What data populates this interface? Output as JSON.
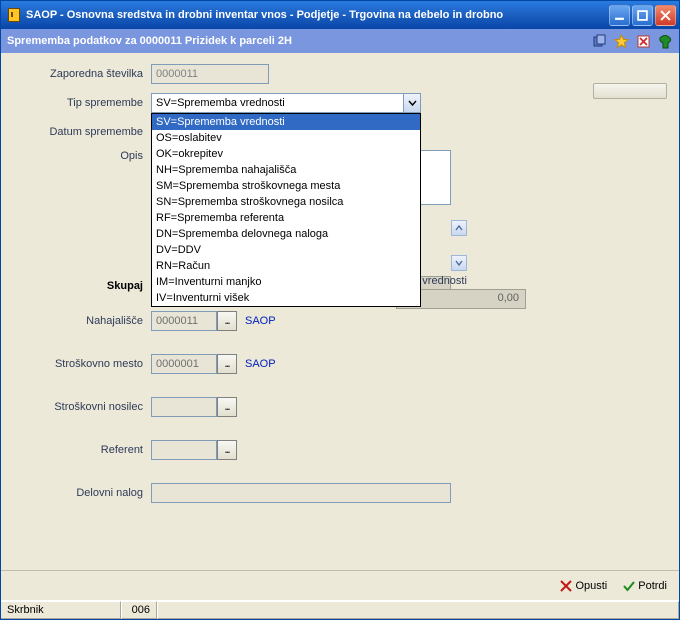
{
  "window": {
    "title": "SAOP  -  Osnovna sredstva in drobni inventar vnos - Podjetje - Trgovina na debelo in drobno"
  },
  "toolbar": {
    "title": "Sprememba podatkov za 0000011 Prizidek k parceli 2H"
  },
  "labels": {
    "seq": "Zaporedna številka",
    "type": "Tip spremembe",
    "date": "Datum spremembe",
    "desc": "Opis",
    "total": "Skupaj",
    "location": "Nahajališče",
    "cost_center": "Stroškovno mesto",
    "cost_carrier": "Stroškovni nosilec",
    "referent": "Referent",
    "work_order": "Delovni nalog"
  },
  "fields": {
    "seq_value": "0000011",
    "type_selected": "SV=Sprememba vrednosti",
    "location_value": "0000011",
    "location_text": "SAOP",
    "cost_center_value": "0000001",
    "cost_center_text": "SAOP"
  },
  "dropdown_options": [
    "SV=Sprememba vrednosti",
    "OS=oslabitev",
    "OK=okrepitev",
    "NH=Sprememba nahajališča",
    "SM=Sprememba stroškovnega mesta",
    "SN=Sprememba stroškovnega nosilca",
    "RF=Sprememba referenta",
    "DN=Sprememba delovnega naloga",
    "DV=DDV",
    "RN=Račun",
    "IM=Inventurni manjko",
    "IV=Inventurni višek"
  ],
  "partial": {
    "label_fragment": "ovek vrednosti",
    "zero": "0,00"
  },
  "footer": {
    "discard": "Opusti",
    "confirm": "Potrdi"
  },
  "status": {
    "user": "Skrbnik",
    "code": "006"
  }
}
